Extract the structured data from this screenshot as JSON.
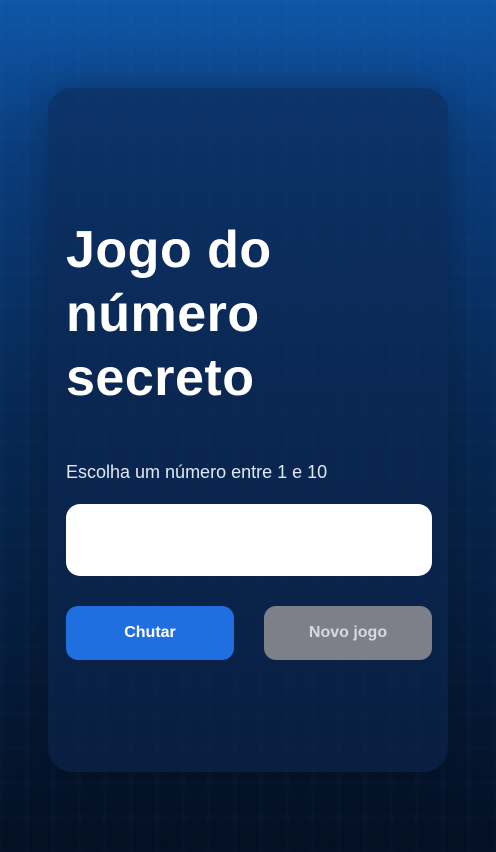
{
  "game": {
    "title": "Jogo do número secreto",
    "instruction": "Escolha um número entre 1 e 10",
    "input": {
      "value": "",
      "placeholder": ""
    },
    "buttons": {
      "guess": "Chutar",
      "restart": "Novo jogo"
    }
  },
  "colors": {
    "background_top": "#0f56a8",
    "background_bottom": "#040f22",
    "primary_button": "#1f6fe0",
    "secondary_button": "#7d8089"
  }
}
